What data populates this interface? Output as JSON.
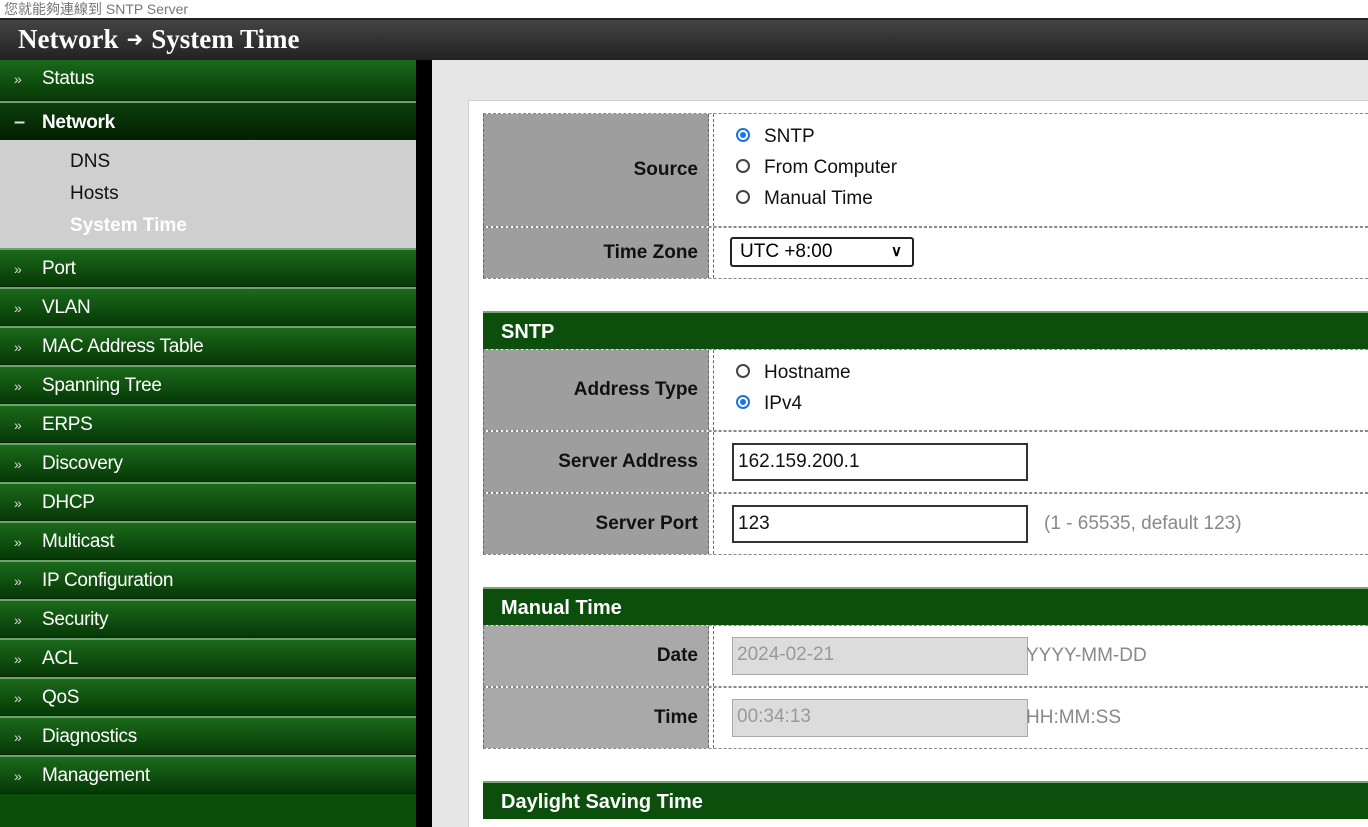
{
  "top_strip": "您就能夠連線到 SNTP Server",
  "breadcrumb": {
    "section": "Network",
    "arrow": "➜",
    "page": "System Time"
  },
  "sidebar": {
    "items_before": [
      {
        "label": "Status",
        "icon": "chevron-double-down-icon"
      }
    ],
    "open_item": {
      "label": "Network",
      "icon": "minus-icon"
    },
    "sub_items": [
      "DNS",
      "Hosts",
      "System Time"
    ],
    "items_after": [
      "Port",
      "VLAN",
      "MAC Address Table",
      "Spanning Tree",
      "ERPS",
      "Discovery",
      "DHCP",
      "Multicast",
      "IP Configuration",
      "Security",
      "ACL",
      "QoS",
      "Diagnostics",
      "Management"
    ]
  },
  "form": {
    "source": {
      "label": "Source",
      "options": [
        "SNTP",
        "From Computer",
        "Manual Time"
      ],
      "selected": "SNTP"
    },
    "time_zone": {
      "label": "Time Zone",
      "value": "UTC +8:00"
    },
    "sntp": {
      "header": "SNTP",
      "address_type": {
        "label": "Address Type",
        "options": [
          "Hostname",
          "IPv4"
        ],
        "selected": "IPv4"
      },
      "server_address": {
        "label": "Server Address",
        "value": "162.159.200.1"
      },
      "server_port": {
        "label": "Server Port",
        "value": "123",
        "hint": "(1 - 65535, default 123)"
      }
    },
    "manual_time": {
      "header": "Manual Time",
      "date": {
        "label": "Date",
        "value": "2024-02-21",
        "hint": "YYYY-MM-DD"
      },
      "time": {
        "label": "Time",
        "value": "00:34:13",
        "hint": "HH:MM:SS"
      }
    },
    "dst": {
      "header": "Daylight Saving Time"
    }
  },
  "colors": {
    "menu_green": "#0b4d0b",
    "section_green": "#0c4f0c",
    "label_gray": "#9e9e9e",
    "radio_blue": "#1a73e8"
  }
}
